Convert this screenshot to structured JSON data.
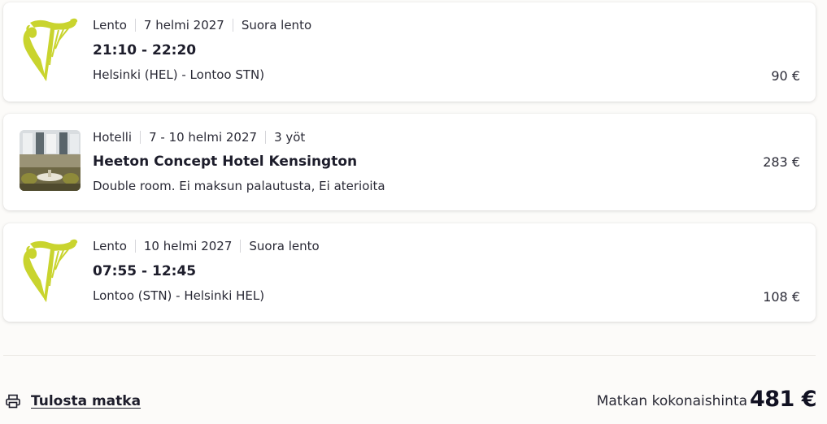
{
  "colors": {
    "airline_logo": "#c9d42e",
    "text": "#1d1d2b",
    "background": "#fcfbf9",
    "card": "#ffffff"
  },
  "items": [
    {
      "type_label": "Lento",
      "date": "7 helmi 2027",
      "extra": "Suora lento",
      "title": "21:10 - 22:20",
      "subtitle": "Helsinki (HEL) - Lontoo STN)",
      "price": "90 €",
      "icon": "harp-logo-icon"
    },
    {
      "type_label": "Hotelli",
      "date": "7 - 10 helmi 2027",
      "extra": "3 yöt",
      "title": "Heeton Concept Hotel Kensington",
      "subtitle": "Double room. Ei maksun palautusta, Ei aterioita",
      "price": "283 €",
      "icon": "hotel-photo"
    },
    {
      "type_label": "Lento",
      "date": "10 helmi 2027",
      "extra": "Suora lento",
      "title": "07:55 - 12:45",
      "subtitle": "Lontoo (STN) - Helsinki HEL)",
      "price": "108 €",
      "icon": "harp-logo-icon"
    }
  ],
  "footer": {
    "print_label": "Tulosta matka",
    "print_icon": "printer-icon",
    "total_label": "Matkan kokonaishinta",
    "total_value": "481 €"
  }
}
